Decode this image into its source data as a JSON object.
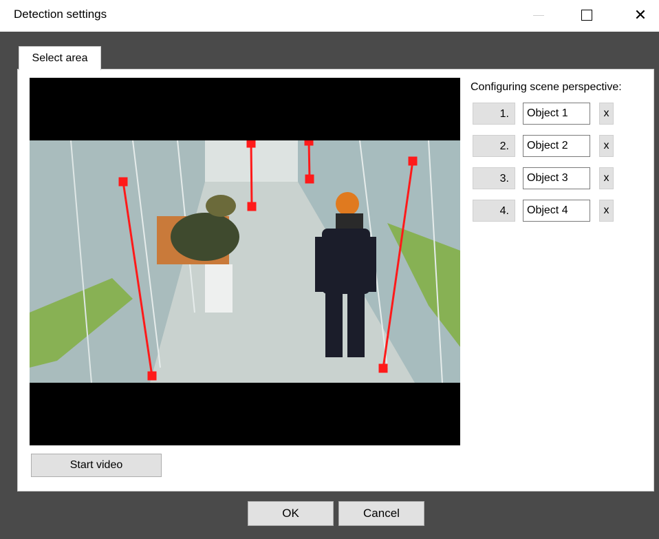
{
  "window": {
    "title": "Detection settings",
    "minimize_glyph": "—",
    "maximize_glyph": "□",
    "close_glyph": "✕"
  },
  "tab": {
    "label": "Select area"
  },
  "perspective": {
    "label": "Configuring scene perspective:",
    "objects": [
      {
        "number": "1.",
        "name": "Object 1",
        "remove": "x"
      },
      {
        "number": "2.",
        "name": "Object 2",
        "remove": "x"
      },
      {
        "number": "3.",
        "name": "Object 3",
        "remove": "x"
      },
      {
        "number": "4.",
        "name": "Object 4",
        "remove": "x"
      }
    ]
  },
  "buttons": {
    "start_video": "Start video",
    "ok": "OK",
    "cancel": "Cancel"
  },
  "colors": {
    "marker": "#ff1a1a",
    "client_bg": "#4a4a4a",
    "button_bg": "#e1e1e1"
  }
}
